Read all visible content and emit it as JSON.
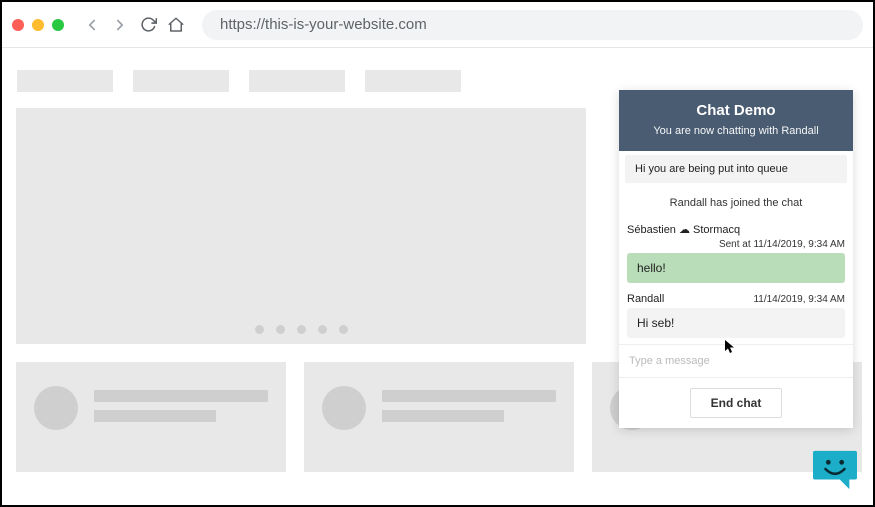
{
  "browser": {
    "url": "https://this-is-your-website.com"
  },
  "chat": {
    "title": "Chat Demo",
    "subtitle": "You are now chatting with Randall",
    "system_queue": "Hi you are being put into queue",
    "system_joined": "Randall has joined the chat",
    "user": {
      "name": "Sébastien ☁ Stormacq",
      "sent_at_label": "Sent at",
      "sent_at_time": "11/14/2019, 9:34 AM",
      "message": "hello!"
    },
    "agent": {
      "name": "Randall",
      "time": "11/14/2019, 9:34 AM",
      "message": "Hi seb!"
    },
    "input_placeholder": "Type a message",
    "end_chat_label": "End chat"
  }
}
